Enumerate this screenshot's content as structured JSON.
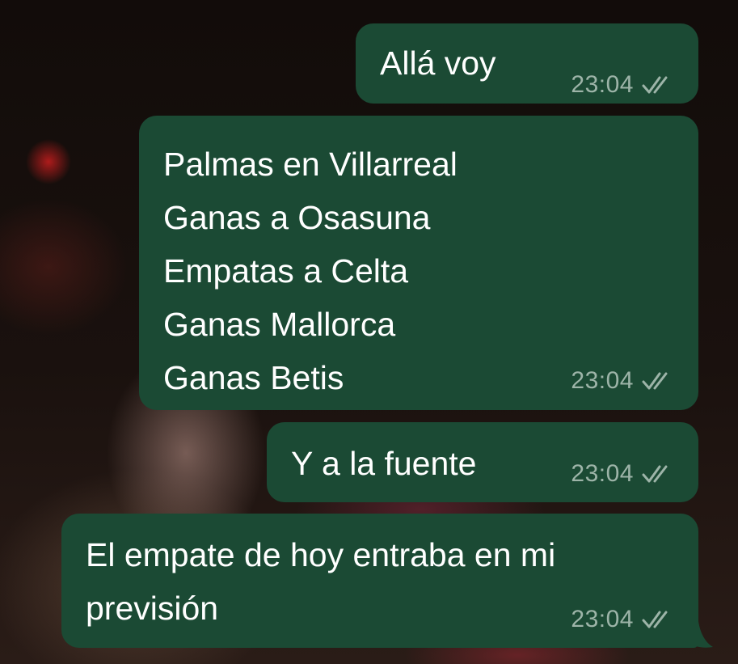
{
  "messages": [
    {
      "text": "Allá voy",
      "time": "23:04",
      "status": "read"
    },
    {
      "text": "Palmas en Villarreal\nGanas a Osasuna\nEmpatas a Celta\nGanas Mallorca\nGanas Betis",
      "time": "23:04",
      "status": "read"
    },
    {
      "text": "Y a la fuente",
      "time": "23:04",
      "status": "read"
    },
    {
      "text": "El empate de hoy entraba en mi\nprevisión",
      "time": "23:04",
      "status": "read"
    }
  ],
  "colors": {
    "bubble_background": "#1b4a34",
    "text": "#ffffff",
    "timestamp": "#9db4a8"
  },
  "icons": {
    "status": "double-check-icon"
  }
}
